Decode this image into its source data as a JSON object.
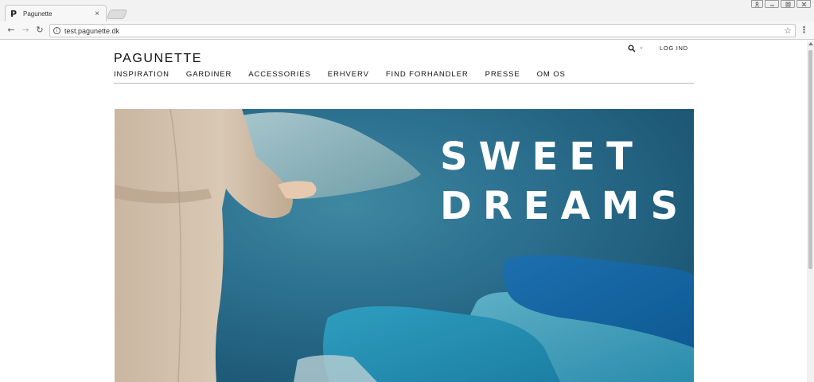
{
  "browser": {
    "tab": {
      "favicon": "P",
      "title": "Pagunette",
      "close": "×"
    },
    "url": "test.pagunette.dk",
    "icons": {
      "back": "arrow-left-icon",
      "forward": "arrow-right-icon",
      "reload": "reload-icon",
      "info": "info-icon",
      "star": "star-icon",
      "menu": "kebab-menu-icon"
    }
  },
  "site": {
    "logo": "PAGUNETTE",
    "header": {
      "login": "LOG IND",
      "search_icon": "search-icon"
    },
    "nav": [
      {
        "label": "INSPIRATION"
      },
      {
        "label": "GARDINER"
      },
      {
        "label": "ACCESSORIES"
      },
      {
        "label": "ERHVERV"
      },
      {
        "label": "FIND FORHANDLER"
      },
      {
        "label": "PRESSE"
      },
      {
        "label": "OM OS"
      }
    ],
    "hero": {
      "line1": "SWEET",
      "line2": "DREAMS",
      "background_color": "#2d7190",
      "text_color": "#ffffff"
    }
  }
}
